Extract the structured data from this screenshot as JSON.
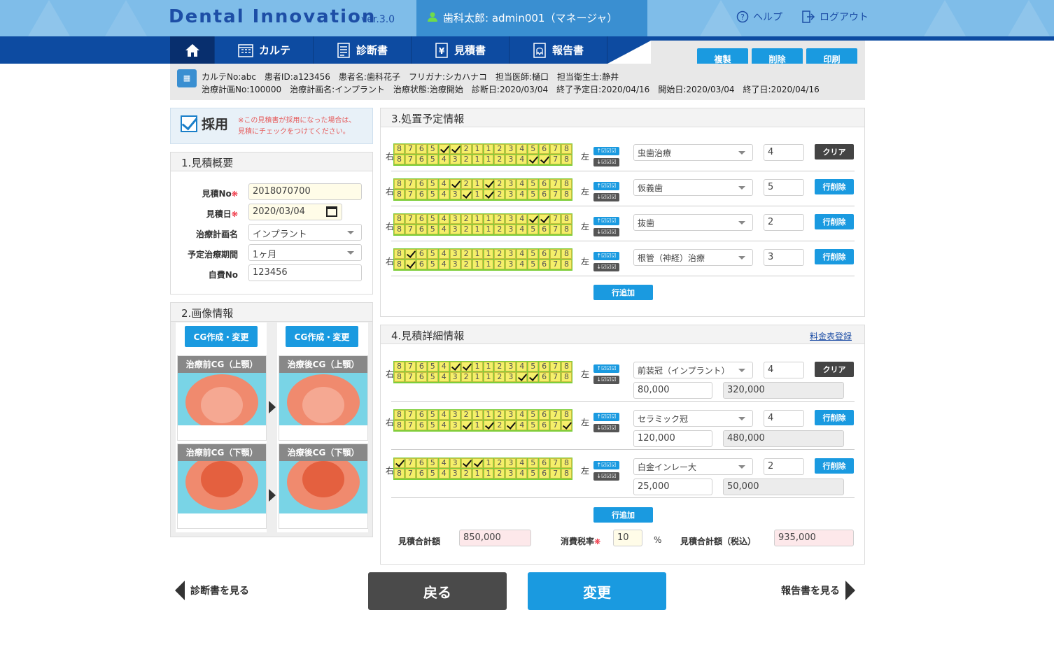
{
  "header": {
    "brand": "Dental Innovation",
    "version": "ver.3.0",
    "user": "歯科太郎: admin001（マネージャ）",
    "help": "ヘルプ",
    "logout": "ログアウト"
  },
  "nav": {
    "home": "home",
    "karte": "カルテ",
    "shindan": "診断書",
    "mitsumori": "見積書",
    "houkoku": "報告書"
  },
  "actions": {
    "copy": "複製",
    "delete": "削除",
    "print": "印刷"
  },
  "info": {
    "line1": "カルテNo:abc　患者ID:a123456　患者名:歯科花子　フリガナ:シカハナコ　担当医師:樋口　担当衛生士:静井",
    "line2": "治療計画No:100000　治療計画名:インプラント　治療状態:治療開始　診断日:2020/03/04　終了予定日:2020/04/16　開始日:2020/03/04　終了日:2020/04/16",
    "icon": "karte-icon"
  },
  "saiyo": {
    "label": "採用",
    "note1": "※この見積書が採用になった場合は、",
    "note2": "見積にチェックをつけてください。"
  },
  "overview": {
    "title": "1.見積概要",
    "fields": [
      {
        "label": "見積No",
        "required": true,
        "value": "2018070700"
      },
      {
        "label": "見積日",
        "required": true,
        "value": "2020/03/04"
      },
      {
        "label": "治療計画名",
        "required": false,
        "value": "インプラント"
      },
      {
        "label": "予定治療期間",
        "required": false,
        "value": "1ヶ月"
      },
      {
        "label": "自費No",
        "required": false,
        "value": "123456"
      }
    ]
  },
  "images": {
    "title": "2.画像情報",
    "cg_button": "CG作成・変更",
    "cards": [
      "治療前CG（上顎）",
      "治療後CG（上顎）",
      "治療前CG（下顎）",
      "治療後CG（下顎）"
    ]
  },
  "plan": {
    "title": "3.処置予定情報",
    "right": "右",
    "left": "左",
    "up": "↑☑☑☑",
    "down": "↓☑☑☑",
    "add": "行追加",
    "rows": [
      {
        "treatment": "虫歯治療",
        "qty": "4",
        "btn": "クリア",
        "top": [
          4,
          5
        ],
        "bot": [
          12,
          13
        ]
      },
      {
        "treatment": "仮義歯",
        "qty": "5",
        "btn": "行削除",
        "top": [
          5,
          8
        ],
        "bot": [
          6,
          8
        ]
      },
      {
        "treatment": "抜歯",
        "qty": "2",
        "btn": "行削除",
        "top": [
          12,
          13
        ],
        "bot": []
      },
      {
        "treatment": "根管（神経）治療",
        "qty": "3",
        "btn": "行削除",
        "top": [
          1
        ],
        "bot": [
          1
        ]
      }
    ]
  },
  "detail": {
    "title": "4.見積詳細情報",
    "price_link": "料金表登録",
    "add": "行追加",
    "rows": [
      {
        "item": "前装冠（インプラント）",
        "qty": "4",
        "unit": "80,000",
        "total": "320,000",
        "btn": "クリア",
        "top": [
          5,
          6
        ],
        "bot": [
          11,
          12
        ]
      },
      {
        "item": "セラミック冠",
        "qty": "4",
        "unit": "120,000",
        "total": "480,000",
        "btn": "行削除",
        "top": [],
        "bot": [
          6,
          8,
          10,
          15
        ]
      },
      {
        "item": "白金インレー大",
        "qty": "2",
        "unit": "25,000",
        "total": "50,000",
        "btn": "行削除",
        "top": [
          0,
          6,
          7
        ],
        "bot": []
      }
    ],
    "sum_label": "見積合計額",
    "sum": "850,000",
    "tax_label": "消費税率",
    "tax": "10",
    "pct": "%",
    "total_label": "見積合計額（税込）",
    "total": "935,000"
  },
  "teeth_labels": [
    "8",
    "7",
    "6",
    "5",
    "4",
    "3",
    "2",
    "1",
    "1",
    "2",
    "3",
    "4",
    "5",
    "6",
    "7",
    "8"
  ],
  "bottom": {
    "prev": "診断書を見る",
    "back": "戻る",
    "change": "変更",
    "next": "報告書を見る"
  }
}
